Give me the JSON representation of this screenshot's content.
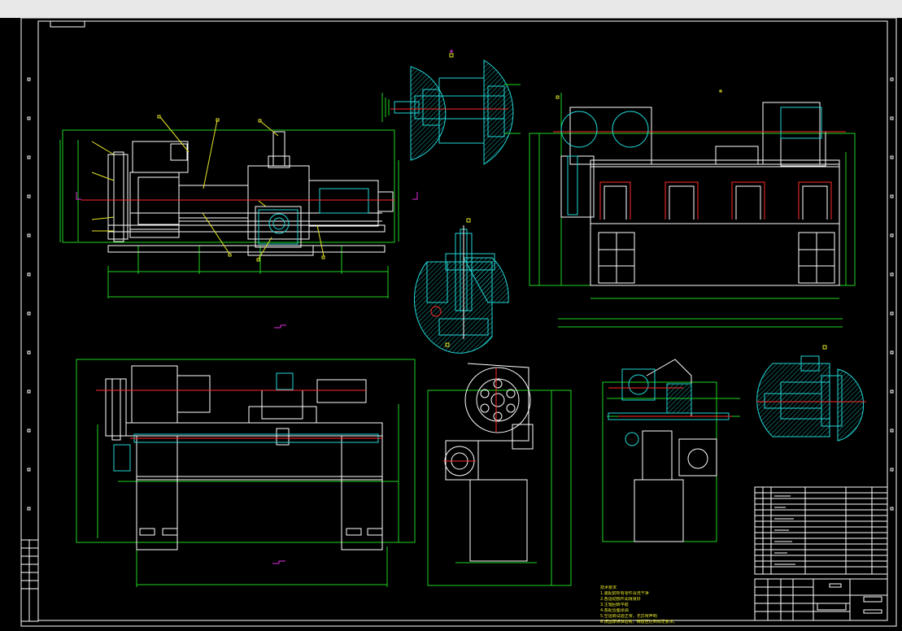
{
  "colors": {
    "background": "#000000",
    "frame": "#ffffff",
    "outline": "#ffffff",
    "dimension": "#1fd31f",
    "section": "#22d6d6",
    "leader": "#e6e62a",
    "centerline": "#ff2a2a",
    "marker": "#e030e0",
    "toolbar": "#e8e8e8"
  },
  "notes": {
    "title": "技术要求",
    "lines": [
      "1.装配前所有零件清洗干净",
      "2.各运动部件润滑良好",
      "3.主轴回转平稳",
      "4.各配合面涂油",
      "5.空运转试验正常，无异常声响",
      "6.按国家标准验收，精度应达到规定要求。"
    ]
  },
  "views": [
    {
      "name": "main-front-view"
    },
    {
      "name": "headstock-section-view"
    },
    {
      "name": "side-front-view"
    },
    {
      "name": "tool-post-section-view"
    },
    {
      "name": "bottom-front-view"
    },
    {
      "name": "belt-drive-end-view"
    },
    {
      "name": "carriage-end-view"
    },
    {
      "name": "tailstock-section-view"
    },
    {
      "name": "parts-list-table"
    },
    {
      "name": "title-block"
    }
  ]
}
